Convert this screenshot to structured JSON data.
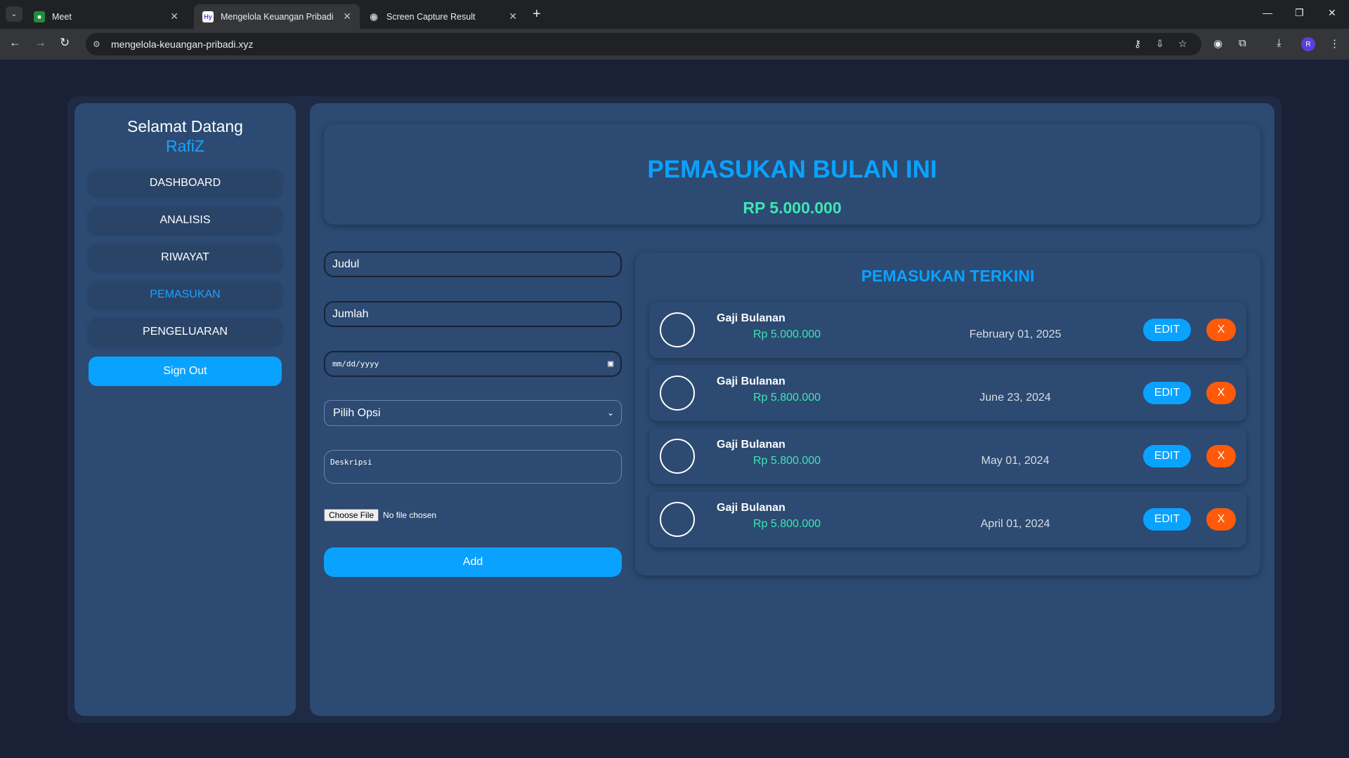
{
  "browser": {
    "tabs": [
      {
        "title": "Meet"
      },
      {
        "title": "Mengelola Keuangan Pribadi",
        "favicon": "Hy"
      },
      {
        "title": "Screen Capture Result"
      }
    ],
    "url": "mengelola-keuangan-pribadi.xyz",
    "profile_initial": "R"
  },
  "sidebar": {
    "welcome": "Selamat Datang",
    "username": "RafiZ",
    "items": [
      {
        "label": "DASHBOARD"
      },
      {
        "label": "ANALISIS"
      },
      {
        "label": "RIWAYAT"
      },
      {
        "label": "PEMASUKAN"
      },
      {
        "label": "PENGELUARAN"
      }
    ],
    "signout": "Sign Out"
  },
  "summary": {
    "title": "PEMASUKAN BULAN INI",
    "amount": "RP 5.000.000"
  },
  "form": {
    "title_placeholder": "Judul",
    "amount_placeholder": "Jumlah",
    "date_placeholder": "mm/dd/yyyy",
    "select_value": "Pilih Opsi",
    "description_placeholder": "Deskripsi",
    "file_button": "Choose File",
    "file_status": "No file chosen",
    "add_label": "Add"
  },
  "recent": {
    "title": "PEMASUKAN TERKINI",
    "edit_label": "EDIT",
    "delete_label": "X",
    "items": [
      {
        "title": "Gaji Bulanan",
        "amount": "Rp 5.000.000",
        "date": "February 01, 2025"
      },
      {
        "title": "Gaji Bulanan",
        "amount": "Rp 5.800.000",
        "date": "June 23, 2024"
      },
      {
        "title": "Gaji Bulanan",
        "amount": "Rp 5.800.000",
        "date": "May 01, 2024"
      },
      {
        "title": "Gaji Bulanan",
        "amount": "Rp 5.800.000",
        "date": "April 01, 2024"
      }
    ]
  },
  "colors": {
    "accent": "#0aa2ff",
    "income": "#3ee6b5",
    "danger": "#ff5a0a",
    "panel": "#2c4a72",
    "background": "#1a2035"
  }
}
